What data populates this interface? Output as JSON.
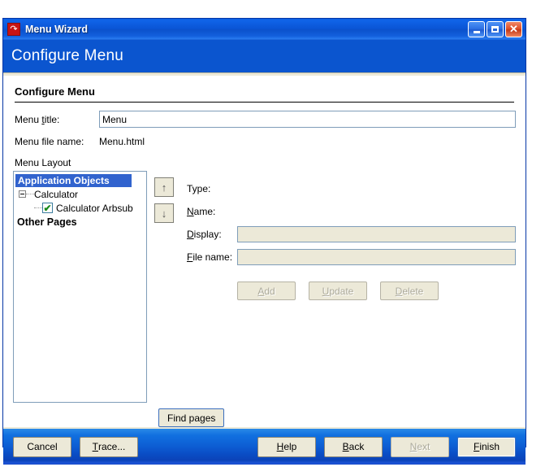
{
  "window": {
    "title": "Menu Wizard",
    "icon": "app-arrow-icon",
    "titlebar_buttons": [
      {
        "name": "minimize",
        "glyph": "_"
      },
      {
        "name": "maximize",
        "glyph": "□"
      },
      {
        "name": "close",
        "glyph": "✕"
      }
    ]
  },
  "header": {
    "title": "Configure Menu"
  },
  "main": {
    "section_title": "Configure Menu",
    "menu_title_label": "Menu title:",
    "menu_title_label_pre": "Menu ",
    "menu_title_label_mnemonic": "t",
    "menu_title_label_post": "itle:",
    "menu_title_value": "Menu",
    "menu_file_name_label": "Menu file name:",
    "menu_file_name_value": "Menu.html",
    "menu_layout_label": "Menu Layout"
  },
  "tree": {
    "nodes": [
      {
        "label": "Application Objects",
        "state": "selected"
      },
      {
        "label": "Calculator",
        "state": "expanded"
      },
      {
        "label": "Calculator Arbsub",
        "state": "checked",
        "check_glyph": "✔"
      },
      {
        "label": "Other Pages",
        "state": "bold"
      }
    ]
  },
  "reorder_buttons": [
    {
      "name": "move-up",
      "glyph": "↑"
    },
    {
      "name": "move-down",
      "glyph": "↓"
    }
  ],
  "detail": {
    "type_label": "Type:",
    "type_value": "",
    "name_label": "Name:",
    "name_label_mnemonic": "N",
    "name_label_post": "ame:",
    "name_value": "",
    "display_label": "Display:",
    "display_label_mnemonic": "D",
    "display_label_post": "isplay:",
    "display_value": "",
    "file_name_label": "File name:",
    "file_name_label_mnemonic": "F",
    "file_name_label_post": "ile name:",
    "file_name_value": "",
    "buttons": [
      {
        "label": "Add",
        "mnemonic": "A",
        "post": "dd",
        "enabled": false
      },
      {
        "label": "Update",
        "mnemonic": "U",
        "post": "pdate",
        "enabled": false
      },
      {
        "label": "Delete",
        "mnemonic": "D",
        "post": "elete",
        "enabled": false
      }
    ],
    "find_pages_label": "Find pages"
  },
  "footer": {
    "left_buttons": [
      {
        "label": "Cancel",
        "enabled": true
      },
      {
        "label": "Trace...",
        "mnemonic": "T",
        "post": "race...",
        "enabled": true
      }
    ],
    "right_buttons": [
      {
        "label": "Help",
        "mnemonic": "H",
        "post": "elp",
        "enabled": true
      },
      {
        "label": "Back",
        "mnemonic": "B",
        "post": "ack",
        "enabled": true
      },
      {
        "label": "Next",
        "mnemonic": "N",
        "post": "ext",
        "enabled": false
      },
      {
        "label": "Finish",
        "mnemonic": "F",
        "post": "inish",
        "enabled": true,
        "default": true
      }
    ]
  },
  "colors": {
    "titlebar_blue": "#0b55cf",
    "selection_blue": "#3163ce",
    "face": "#ece9d8",
    "field_border": "#7f9db9",
    "check_green": "#1a8a1a",
    "close_red": "#c43a17"
  }
}
